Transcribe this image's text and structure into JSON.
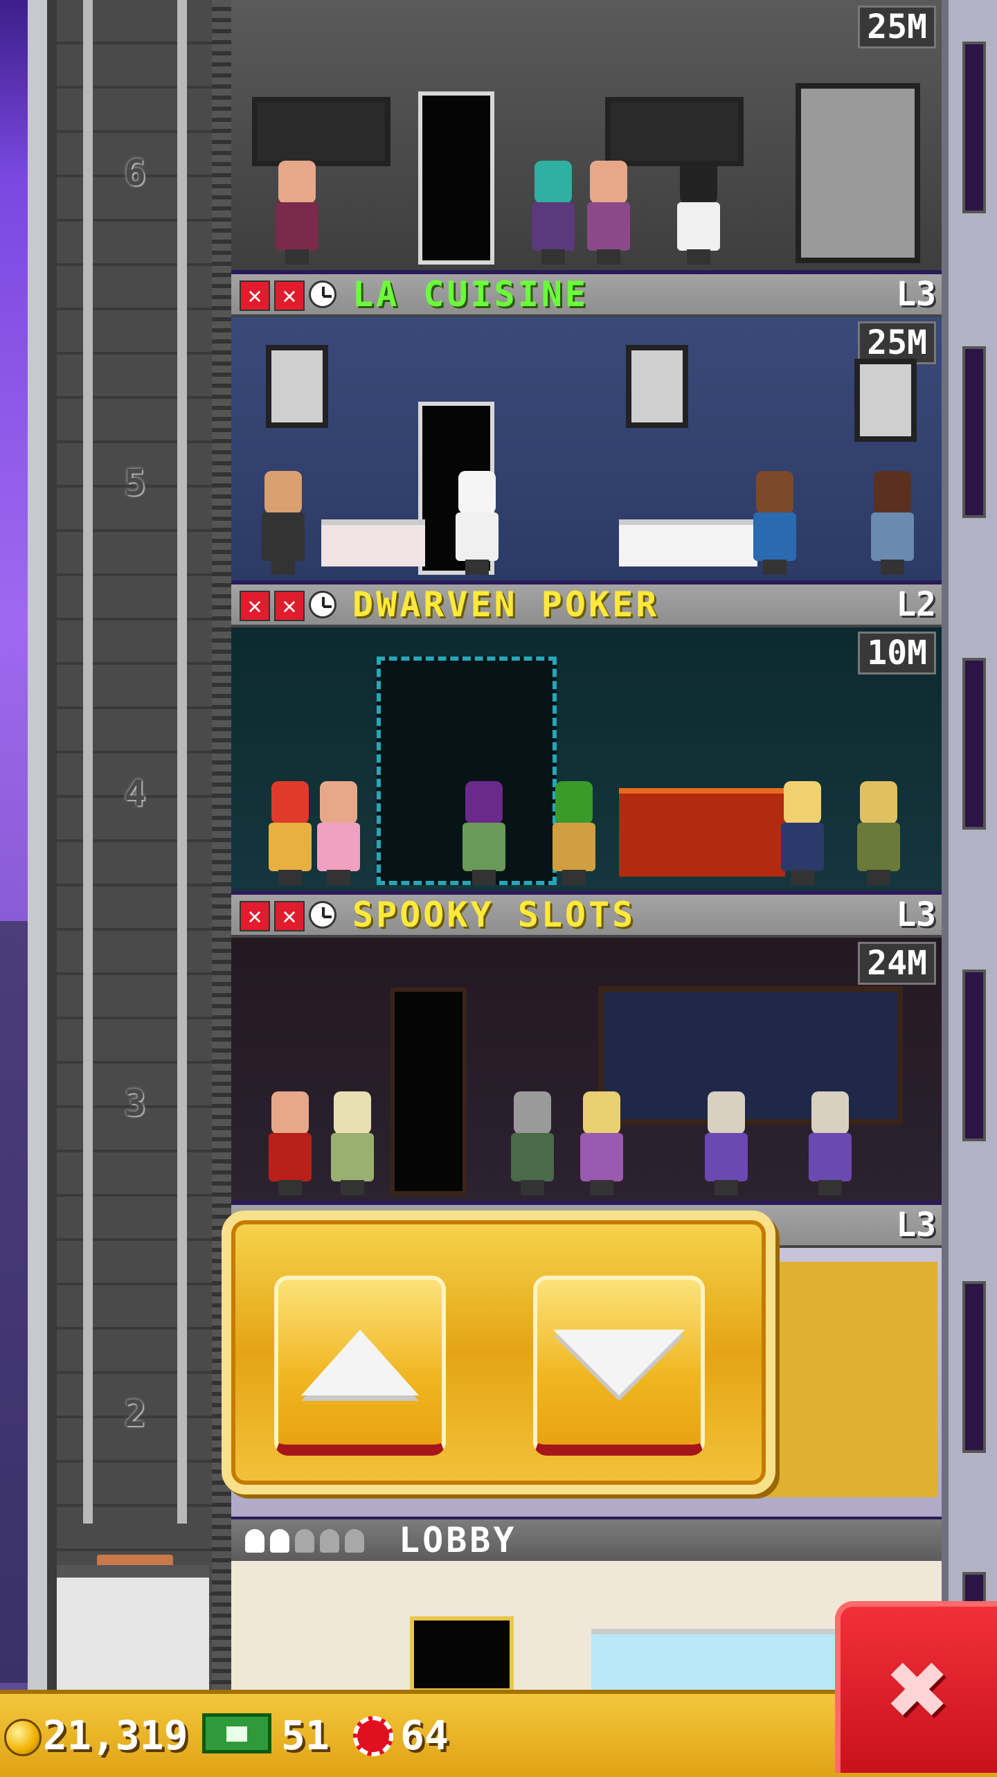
{
  "elevator": {
    "floor_numbers": [
      "6",
      "5",
      "4",
      "3",
      "2"
    ]
  },
  "floors": [
    {
      "name": "",
      "level": "",
      "capacity_badge": "25M",
      "theme_color": "#cfcfcf"
    },
    {
      "name": "LA CUISINE",
      "level": "L3",
      "capacity_badge": "25M",
      "name_color": "#6bff3a"
    },
    {
      "name": "DWARVEN POKER",
      "level": "L2",
      "capacity_badge": "10M",
      "name_color": "#ffe93a"
    },
    {
      "name": "SPOOKY SLOTS",
      "level": "L3",
      "capacity_badge": "24M",
      "name_color": "#ffe93a"
    },
    {
      "name": "",
      "level": "L3",
      "capacity_badge": ""
    }
  ],
  "lobby": {
    "title": "LOBBY"
  },
  "controls": {
    "up_icon": "arrow-up-icon",
    "down_icon": "arrow-down-icon"
  },
  "resources": {
    "coins": "21,319",
    "bux": "51",
    "chips": "64"
  },
  "close_icon": "close-icon"
}
